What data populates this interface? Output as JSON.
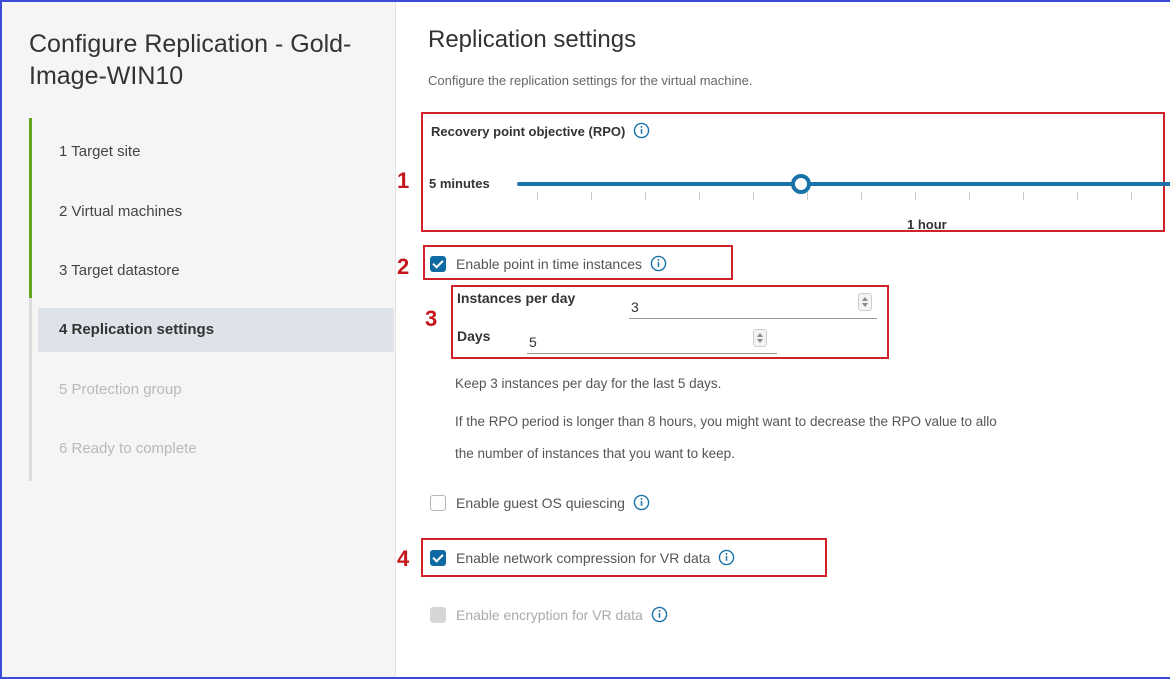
{
  "wizard": {
    "title": "Configure Replication - Gold-Image-WIN10",
    "steps": [
      {
        "label": "1  Target site",
        "state": "done"
      },
      {
        "label": "2  Virtual machines",
        "state": "done"
      },
      {
        "label": "3  Target datastore",
        "state": "done"
      },
      {
        "label": "4  Replication settings",
        "state": "active"
      },
      {
        "label": "5  Protection group",
        "state": "disabled"
      },
      {
        "label": "6  Ready to complete",
        "state": "disabled"
      }
    ]
  },
  "main": {
    "title": "Replication settings",
    "subtitle": "Configure the replication settings for the virtual machine.",
    "rpo": {
      "label": "Recovery point objective (RPO)",
      "value": "5 minutes",
      "tick_label": "1 hour",
      "slider_fraction": 0.43
    },
    "point_in_time": {
      "label": "Enable point in time instances",
      "checked": true
    },
    "instances_per_day": {
      "label": "Instances per day",
      "value": "3"
    },
    "days": {
      "label": "Days",
      "value": "5"
    },
    "help_keep": "Keep 3 instances per day for the last 5 days.",
    "help_rpo_line1": "If the RPO period is longer than 8 hours, you might want to decrease the RPO value to allo",
    "help_rpo_line2": "the number of instances that you want to keep.",
    "guest_os_quiescing": {
      "label": "Enable guest OS quiescing",
      "checked": false
    },
    "network_compression": {
      "label": "Enable network compression for VR data",
      "checked": true
    },
    "encryption": {
      "label": "Enable encryption for VR data",
      "checked": false,
      "disabled": true
    }
  },
  "callouts": [
    "1",
    "2",
    "3",
    "4"
  ],
  "colors": {
    "accent": "#1a73a8",
    "checkbox": "#0f6aa3",
    "progress": "#62a420",
    "highlight_box": "#d0202a"
  },
  "icons": [
    "info-icon",
    "stepper-icon",
    "checkbox-icon"
  ]
}
